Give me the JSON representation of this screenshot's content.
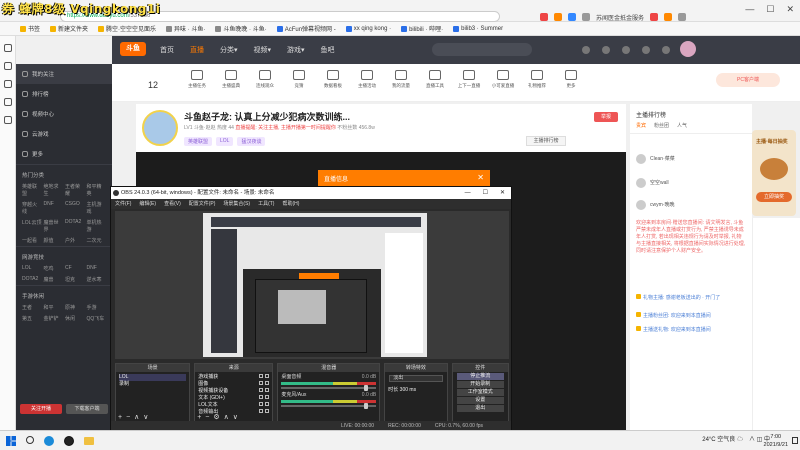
{
  "overlay_title": "券 蜂牌8级 Vqingkong1i",
  "browser": {
    "address_host": "douyu.com",
    "address_path": "/537366",
    "address_prefix": "https://www.",
    "promo_text": "苏闻医金抵金服务",
    "win_controls": [
      "—",
      "☐",
      "✕"
    ],
    "bookmarks": [
      "书签",
      "新建文件夹",
      "腾空·空空空见面乐",
      "异味 · 斗鱼·",
      "斗鱼晚晚 · 斗鱼·",
      "AcFun弹幕视频网 -",
      "xx qing kong ·",
      "bilibili · 哔哩·",
      "bilili ·",
      "bilib3 · Summer"
    ]
  },
  "douyu": {
    "logo": "斗鱼",
    "nav": [
      "首页",
      "直播",
      "分类▾",
      "视频▾",
      "游戏▾",
      "鱼吧"
    ],
    "tools": [
      "主播任务",
      "主播盛典",
      "连线观众",
      "竞猜",
      "数据看板",
      "主播活动",
      "我的流量",
      "直播工具",
      "上下一直播",
      "小可爱直播",
      "礼物推荐",
      "更多"
    ],
    "count": "12",
    "pc_button": "PC客户端",
    "side": {
      "top_nav": [
        "我的关注",
        "排行榜",
        "视频中心",
        "云游戏",
        "更多"
      ],
      "section_hot": "热门分类",
      "hot_grid": [
        "英雄联盟",
        "绝地求生",
        "王者荣耀",
        "和平精英",
        "穿越火线",
        "DNF",
        "CSGO",
        "主机游戏",
        "LOL云顶",
        "魔兽世界",
        "DOTA2",
        "单机热游",
        "一起看",
        "颜值",
        "户外",
        "二次元"
      ],
      "section_game": "网游竞技",
      "game_grid": [
        "LOL",
        "吃鸡",
        "CF",
        "DNF",
        "DOTA2",
        "魔兽",
        "坦克",
        "逆水寒"
      ],
      "section_mobile": "手游休闲",
      "mobile_grid": [
        "王者",
        "和平",
        "原神",
        "手游",
        "第五",
        "金铲铲",
        "休闲",
        "QQ飞车"
      ],
      "follow_left": "关注开播",
      "follow_right": "下载客户端"
    },
    "stream": {
      "title": "斗鱼赵子龙: 认真上分减少犯病次数训练...",
      "meta_level": "LV1",
      "meta_name": "斗鱼·赵赵",
      "meta_heat": "热度 44",
      "meta_notice": "直播提醒: 关注主播, 主播开播第一时间提醒你",
      "meta_fans": "不粉丝数",
      "meta_hot": "456.8w",
      "tags": [
        "英雄联盟",
        "LOL",
        "猛汉夜谈"
      ],
      "rank_button": "主播排行榜",
      "report_button": "举报"
    },
    "chat": {
      "rank_title": "主播排行榜",
      "tabs": [
        "贵宾",
        "粉丝团",
        "人气"
      ],
      "lines": [
        {
          "user": "Clean·菜菜",
          "text": ""
        },
        {
          "user": "空空wall",
          "text": ""
        },
        {
          "user": "cwym·晚晚",
          "text": ""
        }
      ],
      "system": "欢迎来到本房间·赠送您直播间: 请文明发言, 斗鱼严禁未成年人直播或打赏行为, 严禁主播诱导未成年人打赏, 若出现相关违规行为请及时举报, 礼物与主播直接相关, 将根据直播间实际情况进行处理, 同时请注意保护个人财产安全。",
      "sub_lines": [
        "礼物主播: 感谢老板送出的 · 开门了",
        "主播粉丝团: 欢迎来到本直播间",
        "主播送礼物: 欢迎来到本直播间"
      ],
      "gift_title": "主播·每日抽奖",
      "gift_button": "立即抽奖"
    }
  },
  "dialog": {
    "title": "直播信息",
    "close": "✕"
  },
  "obs": {
    "title": "OBS 24.0.3 (64-bit, windows) - 配置文件: 未命名 - 场景: 未命名",
    "menu": [
      "文件(F)",
      "编辑(E)",
      "查看(V)",
      "配置文件(P)",
      "场景集合(S)",
      "工具(T)",
      "帮助(H)"
    ],
    "docks": {
      "scenes": {
        "header": "场景",
        "items": [
          "LOL",
          "录制"
        ]
      },
      "sources": {
        "header": "来源",
        "items": [
          "游戏捕获",
          "图像",
          "视频捕获设备",
          "文本 (GDI+)",
          "LOL文本",
          "音频输出"
        ]
      },
      "mixer": {
        "header": "混音器",
        "channels": [
          {
            "name": "桌面音频",
            "db": "0.0 dB"
          },
          {
            "name": "麦克风/Aux",
            "db": "0.0 dB"
          }
        ]
      },
      "transitions": {
        "header": "转场特效",
        "selected": "淡出",
        "duration_label": "时长",
        "duration_value": "300 ms"
      },
      "controls": {
        "header": "控件",
        "buttons": [
          "停止推流",
          "开始录制",
          "工作室模式",
          "设置",
          "退出"
        ]
      }
    },
    "status": [
      "LIVE: 00:00:00",
      "REC: 00:00:00",
      "CPU: 0.7%, 60.00 fps"
    ]
  },
  "taskbar": {
    "weather": "24°C 空气良 ☁",
    "tray": "∧ ◫ 中",
    "time": "7:00",
    "date": "2021/9/21"
  }
}
